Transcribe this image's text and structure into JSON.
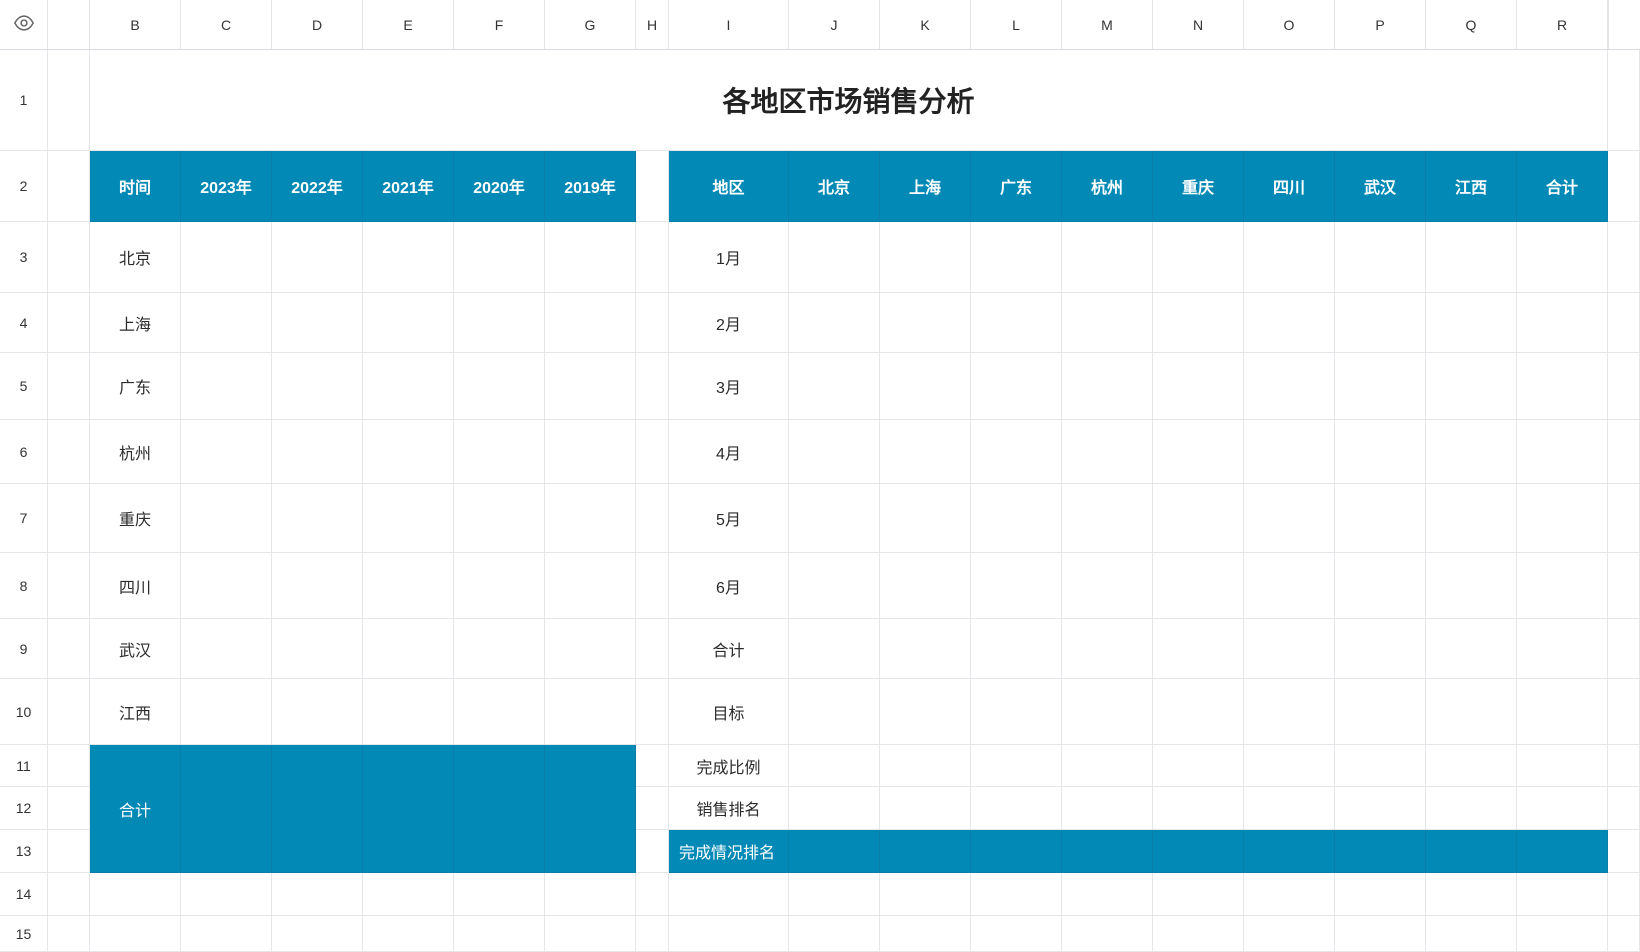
{
  "columns": [
    "B",
    "C",
    "D",
    "E",
    "F",
    "G",
    "H",
    "I",
    "J",
    "K",
    "L",
    "M",
    "N",
    "O",
    "P",
    "Q",
    "R"
  ],
  "rows": [
    "1",
    "2",
    "3",
    "4",
    "5",
    "6",
    "7",
    "8",
    "9",
    "10",
    "11",
    "12",
    "13",
    "14",
    "15"
  ],
  "title": "各地区市场销售分析",
  "left_table": {
    "header": [
      "时间",
      "2023年",
      "2022年",
      "2021年",
      "2020年",
      "2019年"
    ],
    "regions": [
      "北京",
      "上海",
      "广东",
      "杭州",
      "重庆",
      "四川",
      "武汉",
      "江西"
    ],
    "total_label": "合计"
  },
  "right_table": {
    "header": [
      "地区",
      "北京",
      "上海",
      "广东",
      "杭州",
      "重庆",
      "四川",
      "武汉",
      "江西",
      "合计"
    ],
    "row_labels": [
      "1月",
      "2月",
      "3月",
      "4月",
      "5月",
      "6月",
      "合计",
      "目标",
      "完成比例",
      "销售排名"
    ],
    "bottom_label": "完成情况排名"
  },
  "icons": {
    "visibility": "eye-icon"
  },
  "colors": {
    "accent": "#0389b6",
    "grid": "#e4e6ea"
  }
}
